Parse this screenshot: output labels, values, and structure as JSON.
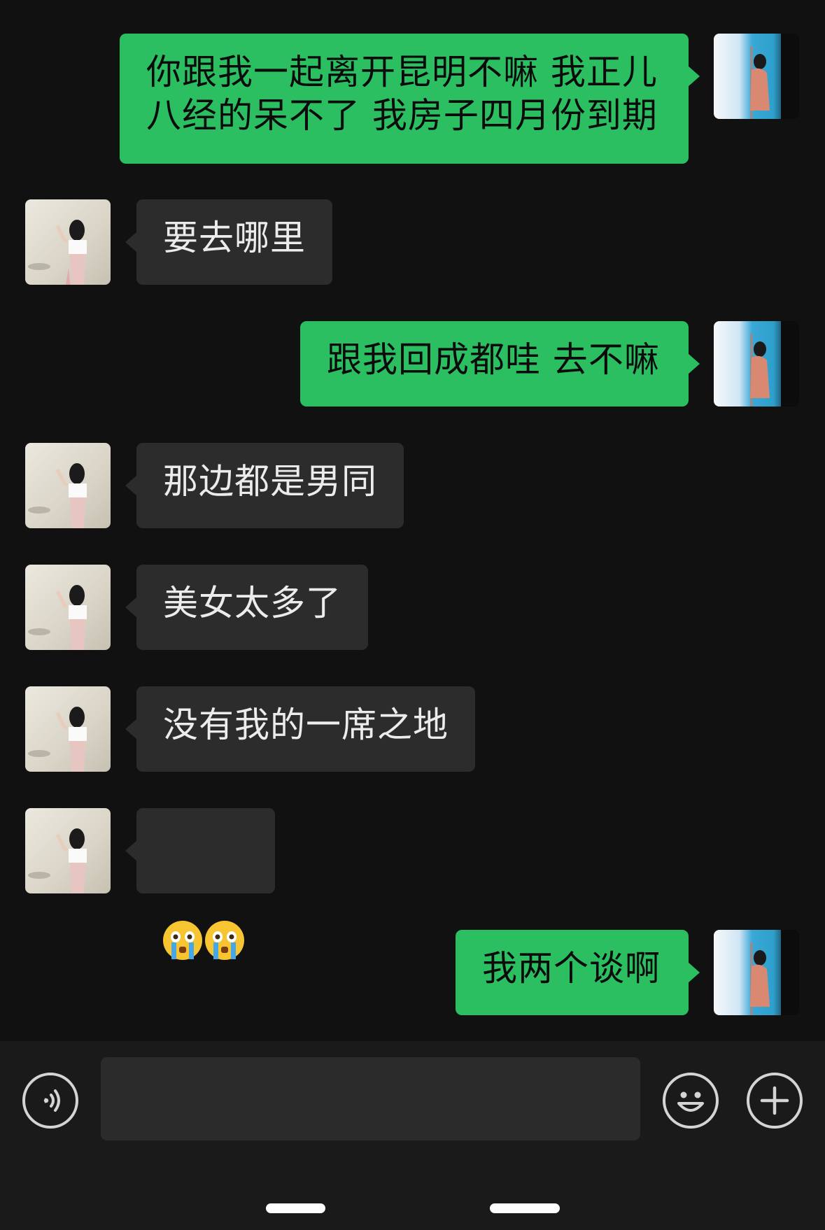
{
  "messages": [
    {
      "sender": "self",
      "text": "你跟我一起离开昆明不嘛 我正儿\n八经的呆不了 我房子四月份到期"
    },
    {
      "sender": "peer",
      "text": "要去哪里"
    },
    {
      "sender": "self",
      "text": "跟我回成都哇 去不嘛"
    },
    {
      "sender": "peer",
      "text": "那边都是男同"
    },
    {
      "sender": "peer",
      "text": "美女太多了"
    },
    {
      "sender": "peer",
      "text": "没有我的一席之地"
    },
    {
      "sender": "peer",
      "emoji": [
        "loudly-crying-face",
        "loudly-crying-face"
      ]
    },
    {
      "sender": "self",
      "text": "我两个谈啊"
    }
  ],
  "input_bar": {
    "voice_icon": "voice-input-icon",
    "input_value": "",
    "emoji_icon": "smiley-face-icon",
    "more_icon": "plus-circle-icon"
  },
  "colors": {
    "background": "#111111",
    "outgoing_bubble": "#2cbf61",
    "incoming_bubble": "#2c2c2c",
    "input_bar": "#1a1a1a"
  }
}
